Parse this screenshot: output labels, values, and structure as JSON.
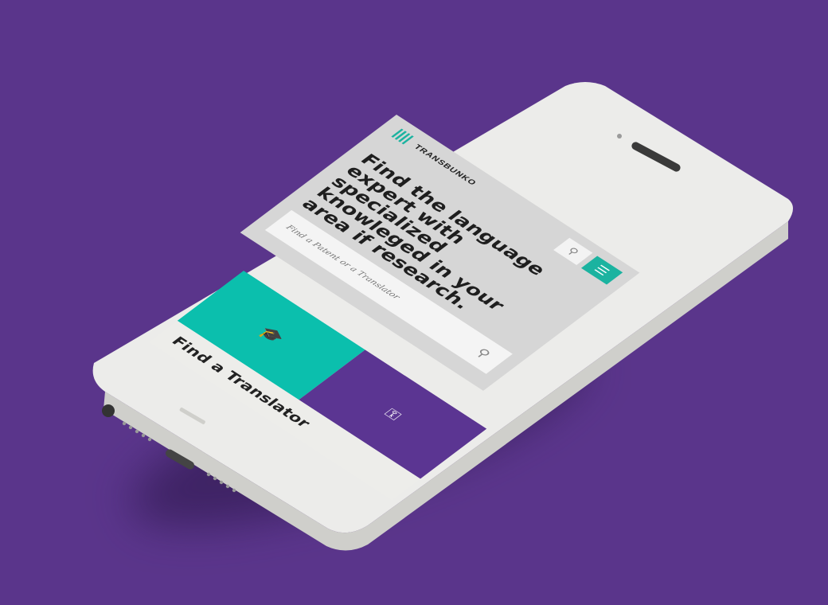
{
  "app": {
    "brand": "TRANSBUNKO",
    "headline": "Find the language expert with specialized knowleged in your area if research.",
    "search": {
      "placeholder": "Find a Patent or a Translator"
    },
    "tiles": {
      "teal_icon": "graduation-cap-icon",
      "purple_icon": "key-icon"
    },
    "find_translator_label": "Find a Translator",
    "colors": {
      "background": "#5a358b",
      "accent": "#1bb3a0",
      "tile_purple": "#5b3592"
    }
  }
}
